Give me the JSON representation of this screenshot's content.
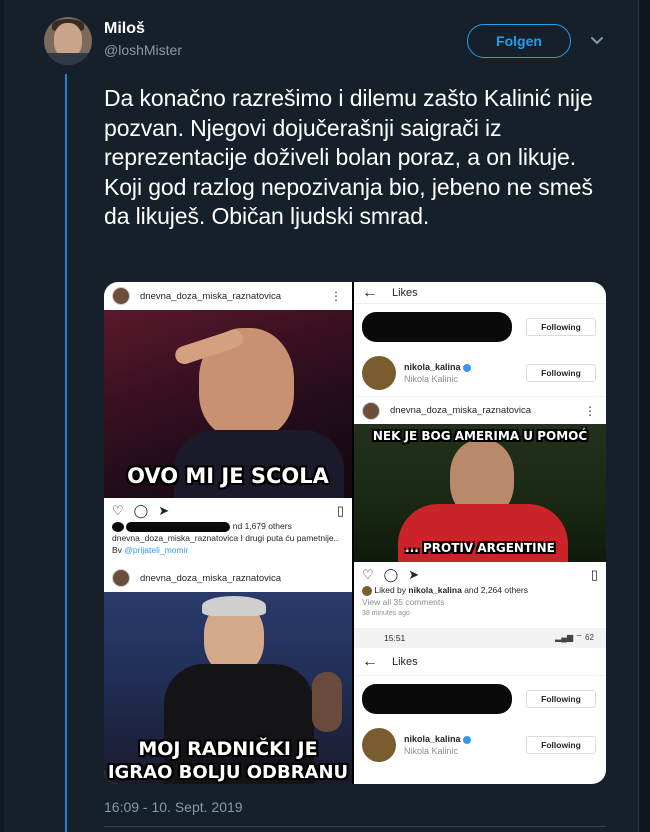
{
  "tweet": {
    "author_name": "Miloš",
    "author_handle": "@loshMister",
    "follow_label": "Folgen",
    "text": "Da konačno razrešimo i dilemu zašto Kalinić nije pozvan. Njegovi dojučerašnji saigrači iz reprezentacije doživeli bolan poraz, a on likuje. Koji god razlog nepozivanja bio, jebeno ne smeš da likuješ. Običan ljudski smrad.",
    "timestamp": "16:09 - 10. Sept. 2019"
  },
  "media": {
    "top_left": {
      "account": "dnevna_doza_miska_raznatovica",
      "meme_caption": "OVO MI JE SCOLA",
      "likes_suffix": "nd 1,679 others",
      "caption_line": "dnevna_doza_miska_raznatovica I drugi puta ću pametnije..",
      "credit_prefix": "Bv",
      "credit_link": "@prijateli_momir"
    },
    "bottom_left": {
      "account": "dnevna_doza_miska_raznatovica",
      "meme_caption_line1": "MOJ RADNIČKI JE",
      "meme_caption_line2": "IGRAO BOLJU ODBRANU"
    },
    "right": {
      "likes_title": "Likes",
      "following_label": "Following",
      "user_name": "nikola_kalina",
      "user_full_name": "Nikola Kalinic",
      "post_account": "dnevna_doza_miska_raznatovica",
      "meme_top": "NEK JE BOG AMERIMA U POMOĆ",
      "meme_bottom": "... PROTIV ARGENTINE",
      "liked_by_prefix": "Liked by",
      "liked_by_user": "nikola_kalina",
      "liked_by_suffix": "and 2,264 others",
      "view_comments": "View all 35 comments",
      "time_ago": "38 minutes ago",
      "status_time": "15:51",
      "status_battery": "62"
    }
  },
  "icons": [
    "chevron-down-icon",
    "heart-icon",
    "comment-icon",
    "share-icon",
    "bookmark-icon",
    "back-arrow-icon",
    "verified-icon",
    "more-dots-icon"
  ]
}
